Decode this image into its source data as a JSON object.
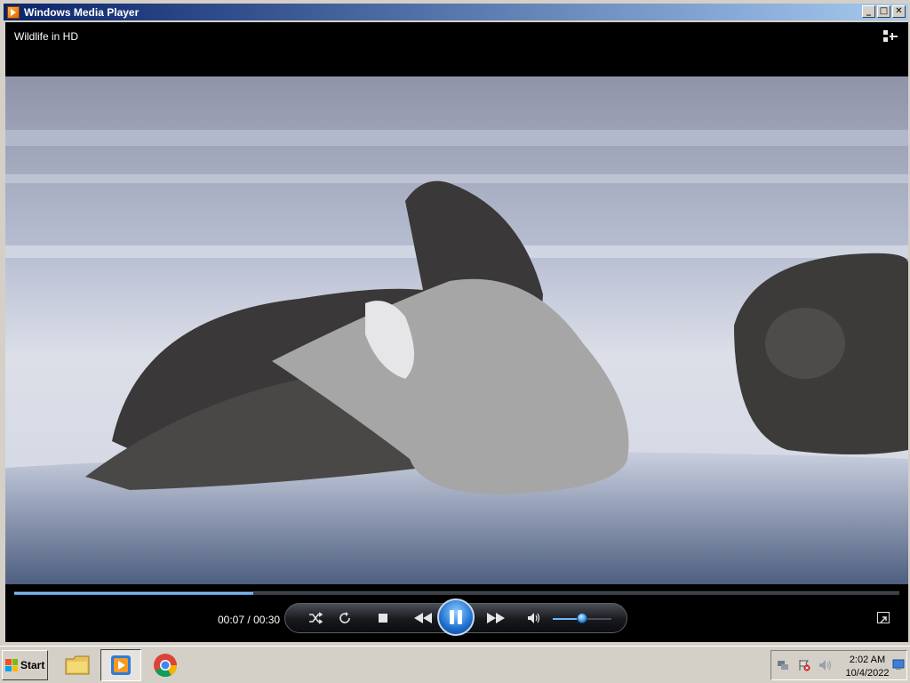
{
  "window": {
    "title": "Windows Media Player",
    "buttons": {
      "minimize": "_",
      "maximize": "□",
      "close": "✕"
    }
  },
  "player": {
    "now_playing": "Wildlife in HD",
    "video_description": "Sea lions resting on a sandy beach",
    "current_time": "00:07",
    "separator": "/",
    "total_time": "00:30",
    "progress_fraction": 0.27,
    "volume_fraction": 0.5,
    "state": "playing"
  },
  "controls": {
    "shuffle_icon": "shuffle-icon",
    "repeat_icon": "repeat-icon",
    "stop_icon": "stop-icon",
    "previous_icon": "rewind-icon",
    "play_pause_icon": "pause-icon",
    "next_icon": "fast-forward-icon",
    "mute_icon": "speaker-icon",
    "fullscreen_icon": "fullscreen-icon",
    "switch_to_library_icon": "switch-to-library-icon"
  },
  "taskbar": {
    "start_label": "Start",
    "pinned": [
      "file-explorer-icon",
      "windows-media-player-icon",
      "chrome-icon"
    ],
    "active": "windows-media-player-icon",
    "clock_time": "2:02 AM",
    "clock_date": "10/4/2022",
    "tray_icons": [
      "network-icon",
      "action-center-warning-icon",
      "volume-icon",
      "show-desktop-icon"
    ]
  },
  "colors": {
    "title_bar_start": "#0a246a",
    "title_bar_end": "#a6caf0",
    "accent": "#3f8fe0",
    "chrome": "#d4d0c8"
  }
}
